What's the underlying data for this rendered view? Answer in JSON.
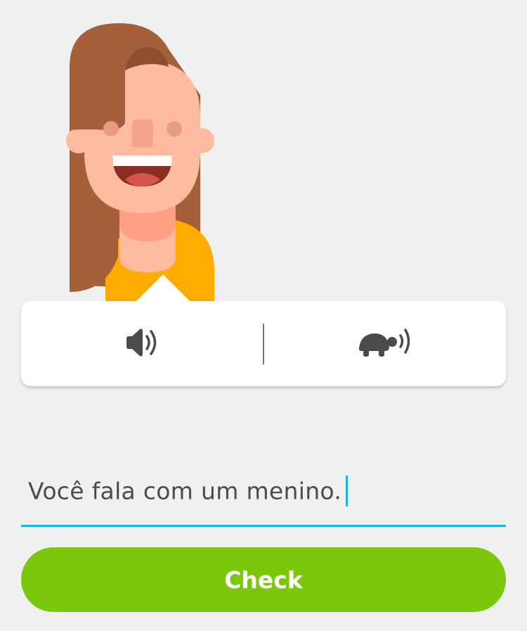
{
  "audio": {
    "normal_icon": "speaker-icon",
    "slow_icon": "turtle-speaker-icon"
  },
  "answer": {
    "value": "Você fala com um menino."
  },
  "check_button": {
    "label": "Check"
  },
  "colors": {
    "background": "#f0f0f0",
    "accent_blue": "#1cb0f6",
    "check_green": "#7ac70c",
    "hair": "#a5603a",
    "skin": "#ffbba0",
    "shirt": "#ffab00"
  }
}
